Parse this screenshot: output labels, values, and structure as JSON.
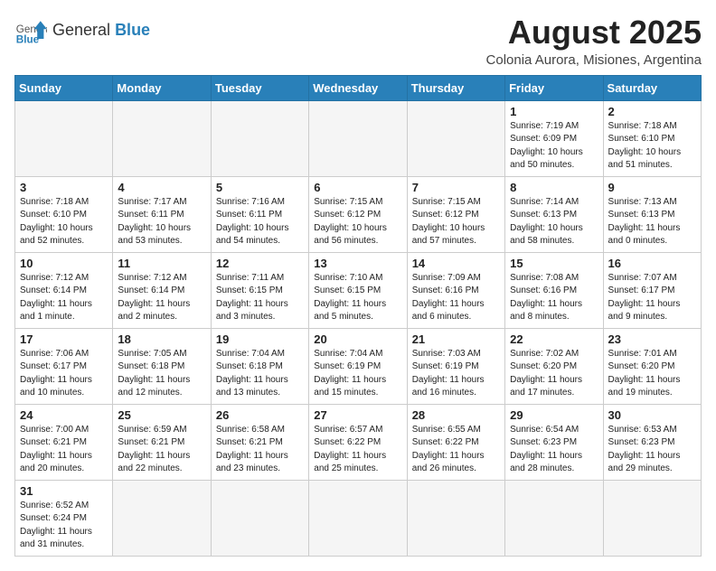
{
  "header": {
    "logo_general": "General",
    "logo_blue": "Blue",
    "month_title": "August 2025",
    "location": "Colonia Aurora, Misiones, Argentina"
  },
  "days_of_week": [
    "Sunday",
    "Monday",
    "Tuesday",
    "Wednesday",
    "Thursday",
    "Friday",
    "Saturday"
  ],
  "weeks": [
    [
      {
        "day": "",
        "info": ""
      },
      {
        "day": "",
        "info": ""
      },
      {
        "day": "",
        "info": ""
      },
      {
        "day": "",
        "info": ""
      },
      {
        "day": "",
        "info": ""
      },
      {
        "day": "1",
        "info": "Sunrise: 7:19 AM\nSunset: 6:09 PM\nDaylight: 10 hours\nand 50 minutes."
      },
      {
        "day": "2",
        "info": "Sunrise: 7:18 AM\nSunset: 6:10 PM\nDaylight: 10 hours\nand 51 minutes."
      }
    ],
    [
      {
        "day": "3",
        "info": "Sunrise: 7:18 AM\nSunset: 6:10 PM\nDaylight: 10 hours\nand 52 minutes."
      },
      {
        "day": "4",
        "info": "Sunrise: 7:17 AM\nSunset: 6:11 PM\nDaylight: 10 hours\nand 53 minutes."
      },
      {
        "day": "5",
        "info": "Sunrise: 7:16 AM\nSunset: 6:11 PM\nDaylight: 10 hours\nand 54 minutes."
      },
      {
        "day": "6",
        "info": "Sunrise: 7:15 AM\nSunset: 6:12 PM\nDaylight: 10 hours\nand 56 minutes."
      },
      {
        "day": "7",
        "info": "Sunrise: 7:15 AM\nSunset: 6:12 PM\nDaylight: 10 hours\nand 57 minutes."
      },
      {
        "day": "8",
        "info": "Sunrise: 7:14 AM\nSunset: 6:13 PM\nDaylight: 10 hours\nand 58 minutes."
      },
      {
        "day": "9",
        "info": "Sunrise: 7:13 AM\nSunset: 6:13 PM\nDaylight: 11 hours\nand 0 minutes."
      }
    ],
    [
      {
        "day": "10",
        "info": "Sunrise: 7:12 AM\nSunset: 6:14 PM\nDaylight: 11 hours\nand 1 minute."
      },
      {
        "day": "11",
        "info": "Sunrise: 7:12 AM\nSunset: 6:14 PM\nDaylight: 11 hours\nand 2 minutes."
      },
      {
        "day": "12",
        "info": "Sunrise: 7:11 AM\nSunset: 6:15 PM\nDaylight: 11 hours\nand 3 minutes."
      },
      {
        "day": "13",
        "info": "Sunrise: 7:10 AM\nSunset: 6:15 PM\nDaylight: 11 hours\nand 5 minutes."
      },
      {
        "day": "14",
        "info": "Sunrise: 7:09 AM\nSunset: 6:16 PM\nDaylight: 11 hours\nand 6 minutes."
      },
      {
        "day": "15",
        "info": "Sunrise: 7:08 AM\nSunset: 6:16 PM\nDaylight: 11 hours\nand 8 minutes."
      },
      {
        "day": "16",
        "info": "Sunrise: 7:07 AM\nSunset: 6:17 PM\nDaylight: 11 hours\nand 9 minutes."
      }
    ],
    [
      {
        "day": "17",
        "info": "Sunrise: 7:06 AM\nSunset: 6:17 PM\nDaylight: 11 hours\nand 10 minutes."
      },
      {
        "day": "18",
        "info": "Sunrise: 7:05 AM\nSunset: 6:18 PM\nDaylight: 11 hours\nand 12 minutes."
      },
      {
        "day": "19",
        "info": "Sunrise: 7:04 AM\nSunset: 6:18 PM\nDaylight: 11 hours\nand 13 minutes."
      },
      {
        "day": "20",
        "info": "Sunrise: 7:04 AM\nSunset: 6:19 PM\nDaylight: 11 hours\nand 15 minutes."
      },
      {
        "day": "21",
        "info": "Sunrise: 7:03 AM\nSunset: 6:19 PM\nDaylight: 11 hours\nand 16 minutes."
      },
      {
        "day": "22",
        "info": "Sunrise: 7:02 AM\nSunset: 6:20 PM\nDaylight: 11 hours\nand 17 minutes."
      },
      {
        "day": "23",
        "info": "Sunrise: 7:01 AM\nSunset: 6:20 PM\nDaylight: 11 hours\nand 19 minutes."
      }
    ],
    [
      {
        "day": "24",
        "info": "Sunrise: 7:00 AM\nSunset: 6:21 PM\nDaylight: 11 hours\nand 20 minutes."
      },
      {
        "day": "25",
        "info": "Sunrise: 6:59 AM\nSunset: 6:21 PM\nDaylight: 11 hours\nand 22 minutes."
      },
      {
        "day": "26",
        "info": "Sunrise: 6:58 AM\nSunset: 6:21 PM\nDaylight: 11 hours\nand 23 minutes."
      },
      {
        "day": "27",
        "info": "Sunrise: 6:57 AM\nSunset: 6:22 PM\nDaylight: 11 hours\nand 25 minutes."
      },
      {
        "day": "28",
        "info": "Sunrise: 6:55 AM\nSunset: 6:22 PM\nDaylight: 11 hours\nand 26 minutes."
      },
      {
        "day": "29",
        "info": "Sunrise: 6:54 AM\nSunset: 6:23 PM\nDaylight: 11 hours\nand 28 minutes."
      },
      {
        "day": "30",
        "info": "Sunrise: 6:53 AM\nSunset: 6:23 PM\nDaylight: 11 hours\nand 29 minutes."
      }
    ],
    [
      {
        "day": "31",
        "info": "Sunrise: 6:52 AM\nSunset: 6:24 PM\nDaylight: 11 hours\nand 31 minutes."
      },
      {
        "day": "",
        "info": ""
      },
      {
        "day": "",
        "info": ""
      },
      {
        "day": "",
        "info": ""
      },
      {
        "day": "",
        "info": ""
      },
      {
        "day": "",
        "info": ""
      },
      {
        "day": "",
        "info": ""
      }
    ]
  ]
}
